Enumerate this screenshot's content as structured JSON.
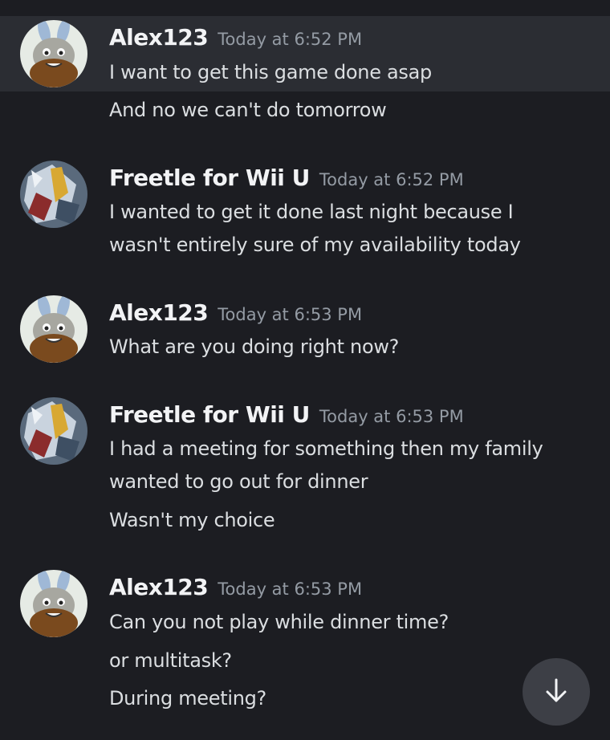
{
  "messages": [
    {
      "author": "Alex123",
      "avatar_icon": "bunny-avatar-icon",
      "time": "Today at 6:52 PM",
      "lines": [
        "I want to get this game done asap",
        "And no we can't do tomorrow"
      ]
    },
    {
      "author": "Freetle for Wii U",
      "avatar_icon": "armored-character-avatar-icon",
      "time": "Today at 6:52 PM",
      "lines": [
        "I wanted to get it done last night because I",
        "wasn't entirely sure of my availability today"
      ]
    },
    {
      "author": "Alex123",
      "avatar_icon": "bunny-avatar-icon",
      "time": "Today at 6:53 PM",
      "lines": [
        "What are you doing right now?"
      ]
    },
    {
      "author": "Freetle for Wii U",
      "avatar_icon": "armored-character-avatar-icon",
      "time": "Today at 6:53 PM",
      "lines": [
        "I had a meeting for something then my family",
        "wanted to go out for dinner",
        "Wasn't my choice"
      ]
    },
    {
      "author": "Alex123",
      "avatar_icon": "bunny-avatar-icon",
      "time": "Today at 6:53 PM",
      "lines": [
        "Can you not play while dinner time?",
        "or multitask?",
        "During meeting?"
      ]
    }
  ],
  "scroll_button": {
    "icon": "arrow-down-icon"
  },
  "colors": {
    "background": "#1c1d22",
    "highlight": "#2b2d33",
    "username": "#f2f3f5",
    "timestamp": "#949ba4",
    "text": "#dbdee1",
    "scroll_button": "#3d3f46"
  }
}
